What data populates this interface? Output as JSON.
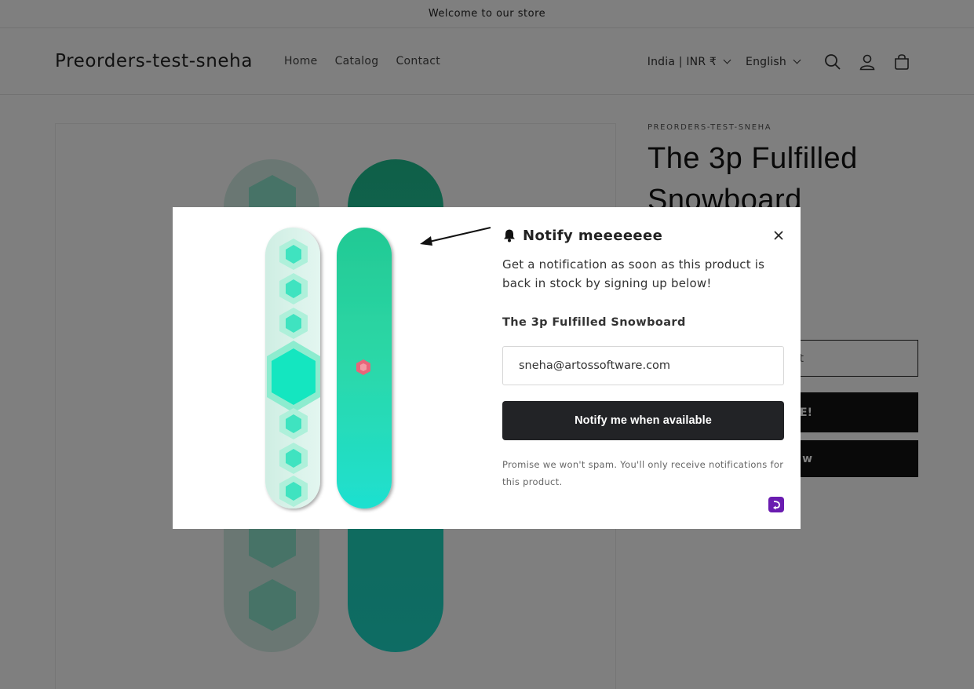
{
  "announcement": "Welcome to our store",
  "header": {
    "logo": "Preorders-test-sneha",
    "nav": [
      "Home",
      "Catalog",
      "Contact"
    ],
    "country": "India | INR ₹",
    "language": "English"
  },
  "product": {
    "vendor": "PREORDERS-TEST-SNEHA",
    "title": "The 3p Fulfilled Snowboard",
    "quantity_hint": "t",
    "preorder_label": "E!",
    "buy_now_label": "w"
  },
  "modal": {
    "title": "Notify meeeeeee",
    "description": "Get a notification as soon as this product is back in stock by signing up below!",
    "product_name": "The 3p Fulfilled Snowboard",
    "email_value": "sneha@artossoftware.com",
    "button_label": "Notify me when available",
    "note": "Promise we won't spam. You'll only receive notifications for this product."
  },
  "colors": {
    "overlay": "rgba(0,0,0,0.5)",
    "button": "#222326",
    "badge": "#6a1cb0",
    "board_teal": "#1fd9b8",
    "board_mint": "#d8f3ea"
  },
  "icons": [
    "search-icon",
    "account-icon",
    "cart-icon",
    "bell-icon",
    "close-icon",
    "app-badge-icon"
  ]
}
